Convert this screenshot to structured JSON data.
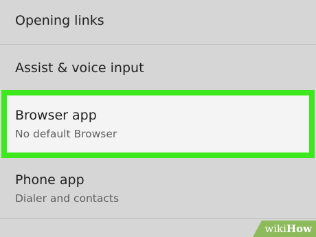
{
  "settings": {
    "items": [
      {
        "title": "Opening links"
      },
      {
        "title": "Assist & voice input"
      },
      {
        "title": "Browser app",
        "subtitle": "No default Browser",
        "highlighted": true
      },
      {
        "title": "Phone app",
        "subtitle": "Dialer and contacts"
      }
    ]
  },
  "highlight_color": "#3ee81f",
  "background_color": "#d6d6d6",
  "watermark": {
    "part1": "wiki",
    "part2": "How",
    "color": "#8dbb5c"
  }
}
